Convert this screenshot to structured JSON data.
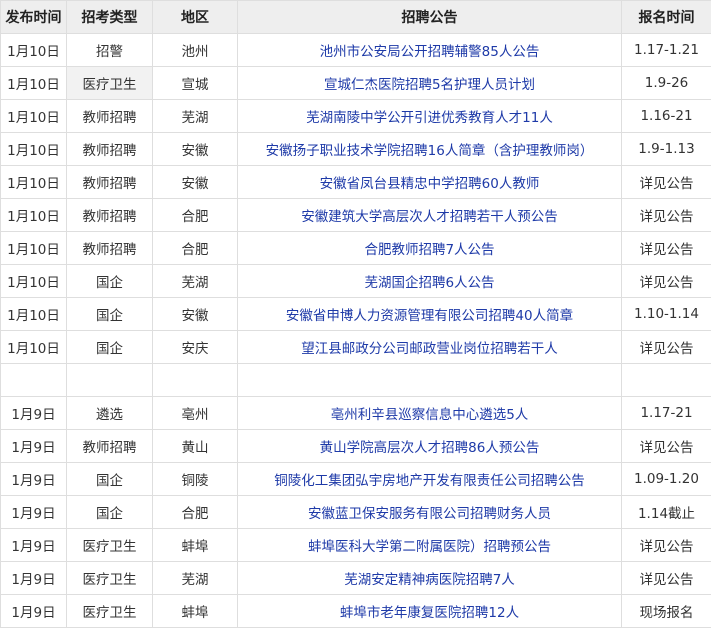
{
  "table": {
    "headers": [
      "发布时间",
      "招考类型",
      "地区",
      "招聘公告",
      "报名时间"
    ],
    "rows_a": [
      [
        "1月10日",
        "招警",
        "池州",
        "池州市公安局公开招聘辅警85人公告",
        "1.17-1.21"
      ],
      [
        "1月10日",
        "医疗卫生",
        "宣城",
        "宣城仁杰医院招聘5名护理人员计划",
        "1.9-26"
      ],
      [
        "1月10日",
        "教师招聘",
        "芜湖",
        "芜湖南陵中学公开引进优秀教育人才11人",
        "1.16-21"
      ],
      [
        "1月10日",
        "教师招聘",
        "安徽",
        "安徽扬子职业技术学院招聘16人简章（含护理教师岗）",
        "1.9-1.13"
      ],
      [
        "1月10日",
        "教师招聘",
        "安徽",
        "安徽省凤台县精忠中学招聘60人教师",
        "详见公告"
      ],
      [
        "1月10日",
        "教师招聘",
        "合肥",
        "安徽建筑大学高层次人才招聘若干人预公告",
        "详见公告"
      ],
      [
        "1月10日",
        "教师招聘",
        "合肥",
        "合肥教师招聘7人公告",
        "详见公告"
      ],
      [
        "1月10日",
        "国企",
        "芜湖",
        "芜湖国企招聘6人公告",
        "详见公告"
      ],
      [
        "1月10日",
        "国企",
        "安徽",
        "安徽省申博人力资源管理有限公司招聘40人简章",
        "1.10-1.14"
      ],
      [
        "1月10日",
        "国企",
        "安庆",
        "望江县邮政分公司邮政营业岗位招聘若干人",
        "详见公告"
      ]
    ],
    "rows_b": [
      [
        "1月9日",
        "遴选",
        "亳州",
        "亳州利辛县巡察信息中心遴选5人",
        "1.17-21"
      ],
      [
        "1月9日",
        "教师招聘",
        "黄山",
        "黄山学院高层次人才招聘86人预公告",
        "详见公告"
      ],
      [
        "1月9日",
        "国企",
        "铜陵",
        "铜陵化工集团弘宇房地产开发有限责任公司招聘公告",
        "1.09-1.20"
      ],
      [
        "1月9日",
        "国企",
        "合肥",
        "安徽蓝卫保安服务有限公司招聘财务人员",
        "1.14截止"
      ],
      [
        "1月9日",
        "医疗卫生",
        "蚌埠",
        "蚌埠医科大学第二附属医院）招聘预公告",
        "详见公告"
      ],
      [
        "1月9日",
        "医疗卫生",
        "芜湖",
        "芜湖安定精神病医院招聘7人",
        "详见公告"
      ],
      [
        "1月9日",
        "医疗卫生",
        "蚌埠",
        "蚌埠市老年康复医院招聘12人",
        "现场报名"
      ]
    ]
  }
}
